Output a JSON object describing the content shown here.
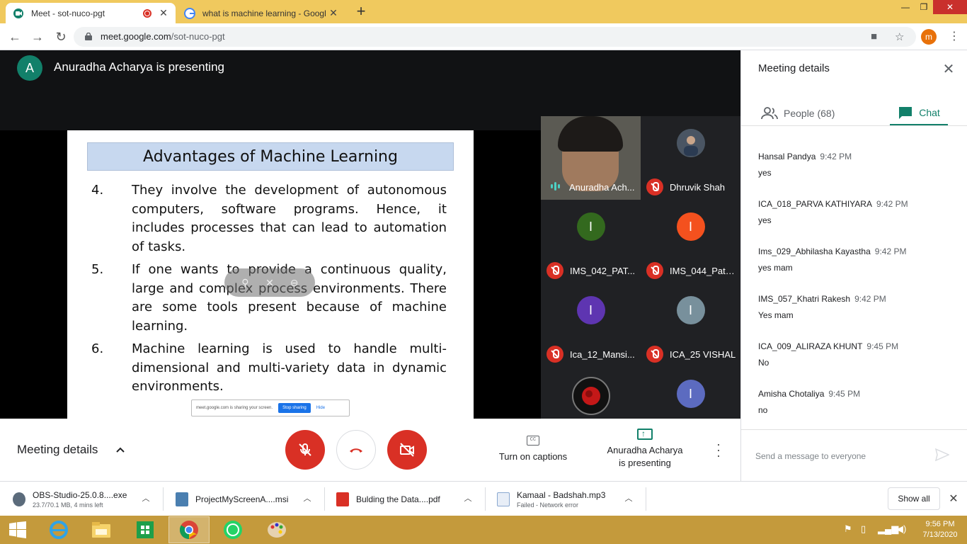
{
  "browser": {
    "tabs": [
      {
        "title": "Meet - sot-nuco-pgt",
        "recording": true
      },
      {
        "title": "what is machine learning - Googl"
      }
    ],
    "url_host": "meet.google.com",
    "url_path": "/sot-nuco-pgt",
    "profile_initial": "m"
  },
  "meet": {
    "presenter_initial": "A",
    "presenter_label": "Anuradha Acharya is presenting",
    "slide": {
      "title": "Advantages of Machine Learning",
      "items": [
        {
          "num": "4.",
          "text": "They involve the development of autonomous computers, software programs. Hence, it includes processes that can lead to automation of tasks."
        },
        {
          "num": "5.",
          "text": "If one wants to provide a continuous quality, large and complex process environments. There are some tools present because of machine learning."
        },
        {
          "num": "6.",
          "text": "Machine learning is used to handle multi-dimensional and multi-variety data in dynamic environments."
        }
      ],
      "share_banner_text": "meet.google.com is sharing your screen.",
      "stop_sharing": "Stop sharing",
      "hide": "Hide"
    },
    "tiles": [
      {
        "name": "Anuradha Ach...",
        "type": "video"
      },
      {
        "name": "Dhruvik Shah",
        "type": "photo"
      },
      {
        "name": "IMS_042_PAT...",
        "initial": "I",
        "color": "#33691e"
      },
      {
        "name": "IMS_044_Pate...",
        "initial": "I",
        "color": "#f4511e"
      },
      {
        "name": "Ica_12_Mansi...",
        "initial": "I",
        "color": "#5e35b1"
      },
      {
        "name": "ICA_25 VISHAL",
        "initial": "I",
        "color": "#78909c"
      },
      {
        "name": "",
        "type": "rose"
      },
      {
        "name": "",
        "initial": "I",
        "color": "#5c6bc0"
      }
    ],
    "controls": {
      "meeting_details": "Meeting details",
      "captions": "Turn on captions",
      "presenting_line1": "Anuradha Acharya",
      "presenting_line2": "is presenting"
    }
  },
  "panel": {
    "title": "Meeting details",
    "people_tab": "People (68)",
    "chat_tab": "Chat",
    "messages": [
      {
        "sender": "Hansal Pandya",
        "time": "9:42 PM",
        "body": "yes"
      },
      {
        "sender": "ICA_018_PARVA KATHIYARA",
        "time": "9:42 PM",
        "body": "yes"
      },
      {
        "sender": "Ims_029_Abhilasha Kayastha",
        "time": "9:42 PM",
        "body": "yes mam"
      },
      {
        "sender": "IMS_057_Khatri Rakesh",
        "time": "9:42 PM",
        "body": "Yes mam"
      },
      {
        "sender": "ICA_009_ALIRAZA KHUNT",
        "time": "9:45 PM",
        "body": "No"
      },
      {
        "sender": "Amisha Chotaliya",
        "time": "9:45 PM",
        "body": "no"
      }
    ],
    "compose_placeholder": "Send a message to everyone"
  },
  "downloads": [
    {
      "name": "OBS-Studio-25.0.8....exe",
      "sub": "23.7/70.1 MB, 4 mins left"
    },
    {
      "name": "ProjectMyScreenA....msi",
      "sub": ""
    },
    {
      "name": "Bulding the Data....pdf",
      "sub": ""
    },
    {
      "name": "Kamaal - Badshah.mp3",
      "sub": "Failed - Network error"
    }
  ],
  "show_all": "Show all",
  "taskbar": {
    "time": "9:56 PM",
    "date": "7/13/2020"
  }
}
